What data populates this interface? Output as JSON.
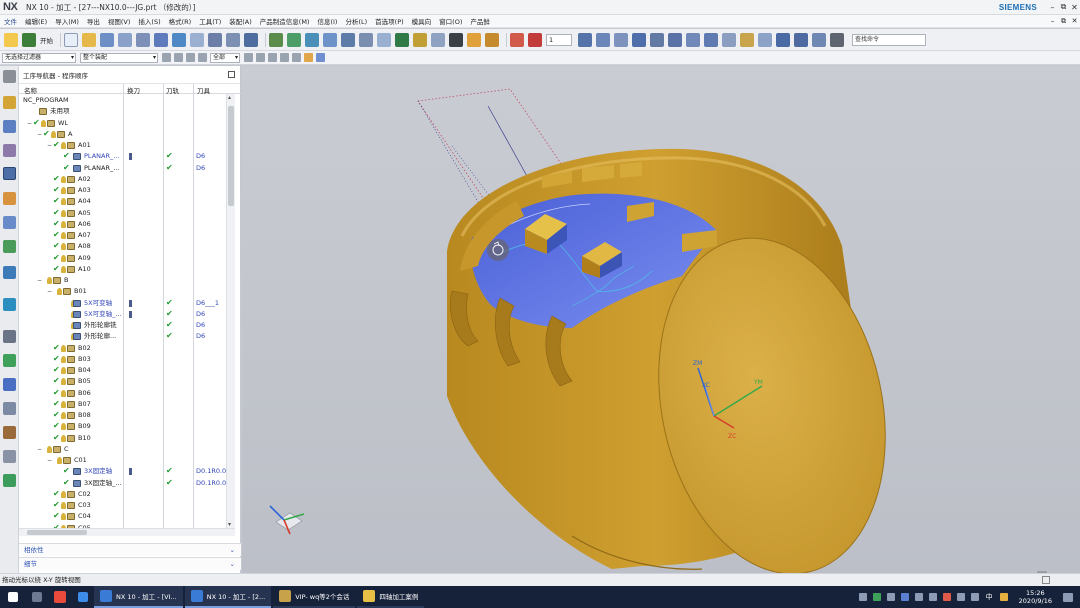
{
  "window": {
    "logo": "NX",
    "title": "NX 10 - 加工 - [27---NX10.0---JG.prt （修改的）]",
    "brand": "SIEMENS",
    "controls": [
      "–",
      "⧉",
      "✕"
    ]
  },
  "menubar": {
    "start": "文件",
    "items": [
      "编辑(E)",
      "导入(M)",
      "导出",
      "视图(V)",
      "插入(S)",
      "格式(R)",
      "工具(T)",
      "装配(A)",
      "产品制造信息(M)",
      "信息(I)",
      "分析(L)",
      "首选项(P)",
      "模具向",
      "窗口(O)",
      "产品鲜"
    ],
    "doc_controls": [
      "–",
      "⧉",
      "✕"
    ]
  },
  "toolbar": {
    "start_label": "开始",
    "zoom_value": "1",
    "search_placeholder": "查找命令"
  },
  "filterbar": {
    "filter_value": "无选择过滤器",
    "assembly_value": "整个装配",
    "scope_value": "全部"
  },
  "navigator": {
    "title": "工序导航器 - 程序顺序",
    "columns": [
      "名称",
      "换刀",
      "刀轨",
      "刀具"
    ],
    "rows": [
      {
        "level": 0,
        "type": "root",
        "label": "NC_PROGRAM"
      },
      {
        "level": 1,
        "type": "folder",
        "label": "未用项"
      },
      {
        "level": 1,
        "type": "group",
        "label": "WL",
        "exp": "−"
      },
      {
        "level": 2,
        "type": "group",
        "label": "A",
        "exp": "−"
      },
      {
        "level": 3,
        "type": "group",
        "label": "A01",
        "exp": "−"
      },
      {
        "level": 4,
        "type": "op",
        "label": "PLANAR_...",
        "blue": true,
        "tc": true,
        "tp": true,
        "tool": "D6"
      },
      {
        "level": 4,
        "type": "op",
        "label": "PLANAR_...",
        "tp": true,
        "tool": "D6"
      },
      {
        "level": 3,
        "type": "group",
        "label": "A02"
      },
      {
        "level": 3,
        "type": "group",
        "label": "A03"
      },
      {
        "level": 3,
        "type": "group",
        "label": "A04"
      },
      {
        "level": 3,
        "type": "group",
        "label": "A05"
      },
      {
        "level": 3,
        "type": "group",
        "label": "A06"
      },
      {
        "level": 3,
        "type": "group",
        "label": "A07"
      },
      {
        "level": 3,
        "type": "group",
        "label": "A08"
      },
      {
        "level": 3,
        "type": "group",
        "label": "A09"
      },
      {
        "level": 3,
        "type": "group",
        "label": "A10"
      },
      {
        "level": 2,
        "type": "group",
        "label": "B",
        "exp": "−",
        "nocheck": true
      },
      {
        "level": 3,
        "type": "group",
        "label": "B01",
        "exp": "−",
        "nocheck": true
      },
      {
        "level": 4,
        "type": "op2",
        "label": "5X可变轴",
        "blue": true,
        "tc": true,
        "tp": true,
        "tool": "D6___1",
        "nocheck": true
      },
      {
        "level": 4,
        "type": "op2",
        "label": "5X可变轴_...",
        "blue": true,
        "tc": true,
        "tp": true,
        "tool": "D6",
        "nocheck": true
      },
      {
        "level": 4,
        "type": "op2",
        "label": "外形轮廓铣",
        "tp": true,
        "tool": "D6",
        "nocheck": true
      },
      {
        "level": 4,
        "type": "op2",
        "label": "外形轮廓...",
        "tp": true,
        "tool": "D6",
        "nocheck": true
      },
      {
        "level": 3,
        "type": "group",
        "label": "B02"
      },
      {
        "level": 3,
        "type": "group",
        "label": "B03"
      },
      {
        "level": 3,
        "type": "group",
        "label": "B04"
      },
      {
        "level": 3,
        "type": "group",
        "label": "B05"
      },
      {
        "level": 3,
        "type": "group",
        "label": "B06"
      },
      {
        "level": 3,
        "type": "group",
        "label": "B07"
      },
      {
        "level": 3,
        "type": "group",
        "label": "B08"
      },
      {
        "level": 3,
        "type": "group",
        "label": "B09"
      },
      {
        "level": 3,
        "type": "group",
        "label": "B10"
      },
      {
        "level": 2,
        "type": "group",
        "label": "C",
        "exp": "−",
        "nocheck": true
      },
      {
        "level": 3,
        "type": "group",
        "label": "C01",
        "exp": "−",
        "nocheck": true
      },
      {
        "level": 4,
        "type": "op2",
        "label": "3X固定轴",
        "blue": true,
        "tc": true,
        "tp": true,
        "tool": "D0.1R0.0"
      },
      {
        "level": 4,
        "type": "op2",
        "label": "3X固定轴_...",
        "tp": true,
        "tool": "D0.1R0.0"
      },
      {
        "level": 3,
        "type": "group",
        "label": "C02"
      },
      {
        "level": 3,
        "type": "group",
        "label": "C03"
      },
      {
        "level": 3,
        "type": "group",
        "label": "C04"
      },
      {
        "level": 3,
        "type": "group",
        "label": "C05"
      }
    ],
    "dependencies_label": "相依性",
    "details_label": "细节"
  },
  "viewport": {
    "wcs_labels": [
      "ZM",
      "XC",
      "YM",
      "ZC"
    ]
  },
  "status": {
    "message": "拖动光标以绕 X-Y 旋转视图"
  },
  "taskbar": {
    "apps": [
      "NX 10 - 加工 - [VI...",
      "NX 10 - 加工 - [2...",
      "VIP- wq等2个会话",
      "四轴加工案例"
    ],
    "lang": "中",
    "time": "15:26",
    "date": "2020/9/16"
  },
  "colors": {
    "part_body": "#c69a2c",
    "part_face": "#d6ac3c",
    "pocket_floor": "#5b70e0",
    "check_green": "#1f9a2e",
    "link_blue": "#3045b6",
    "siemens_teal": "#1d6fb8"
  }
}
